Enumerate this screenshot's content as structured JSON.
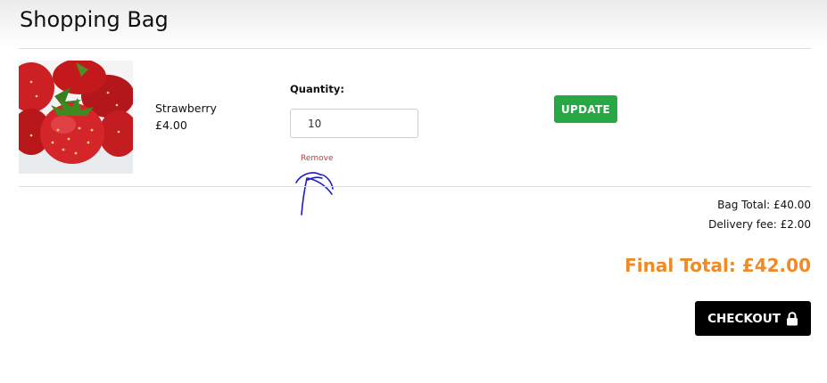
{
  "page": {
    "title": "Shopping Bag"
  },
  "item": {
    "name": "Strawberry",
    "price": "£4.00",
    "image_icon": "strawberry-product-image",
    "quantity_label": "Quantity:",
    "quantity_value": "10",
    "remove_label": "Remove",
    "update_label": "UPDATE"
  },
  "summary": {
    "bag_total": "Bag Total: £40.00",
    "delivery_fee": "Delivery fee: £2.00",
    "final_total": "Final Total: £42.00"
  },
  "checkout": {
    "label": "CHECKOUT",
    "icon": "lock-icon"
  },
  "colors": {
    "update_green": "#28a745",
    "final_total_orange": "#f08a24",
    "remove_red": "#c23a3a",
    "annotation_blue": "#1a1acc",
    "checkout_black": "#000000"
  }
}
